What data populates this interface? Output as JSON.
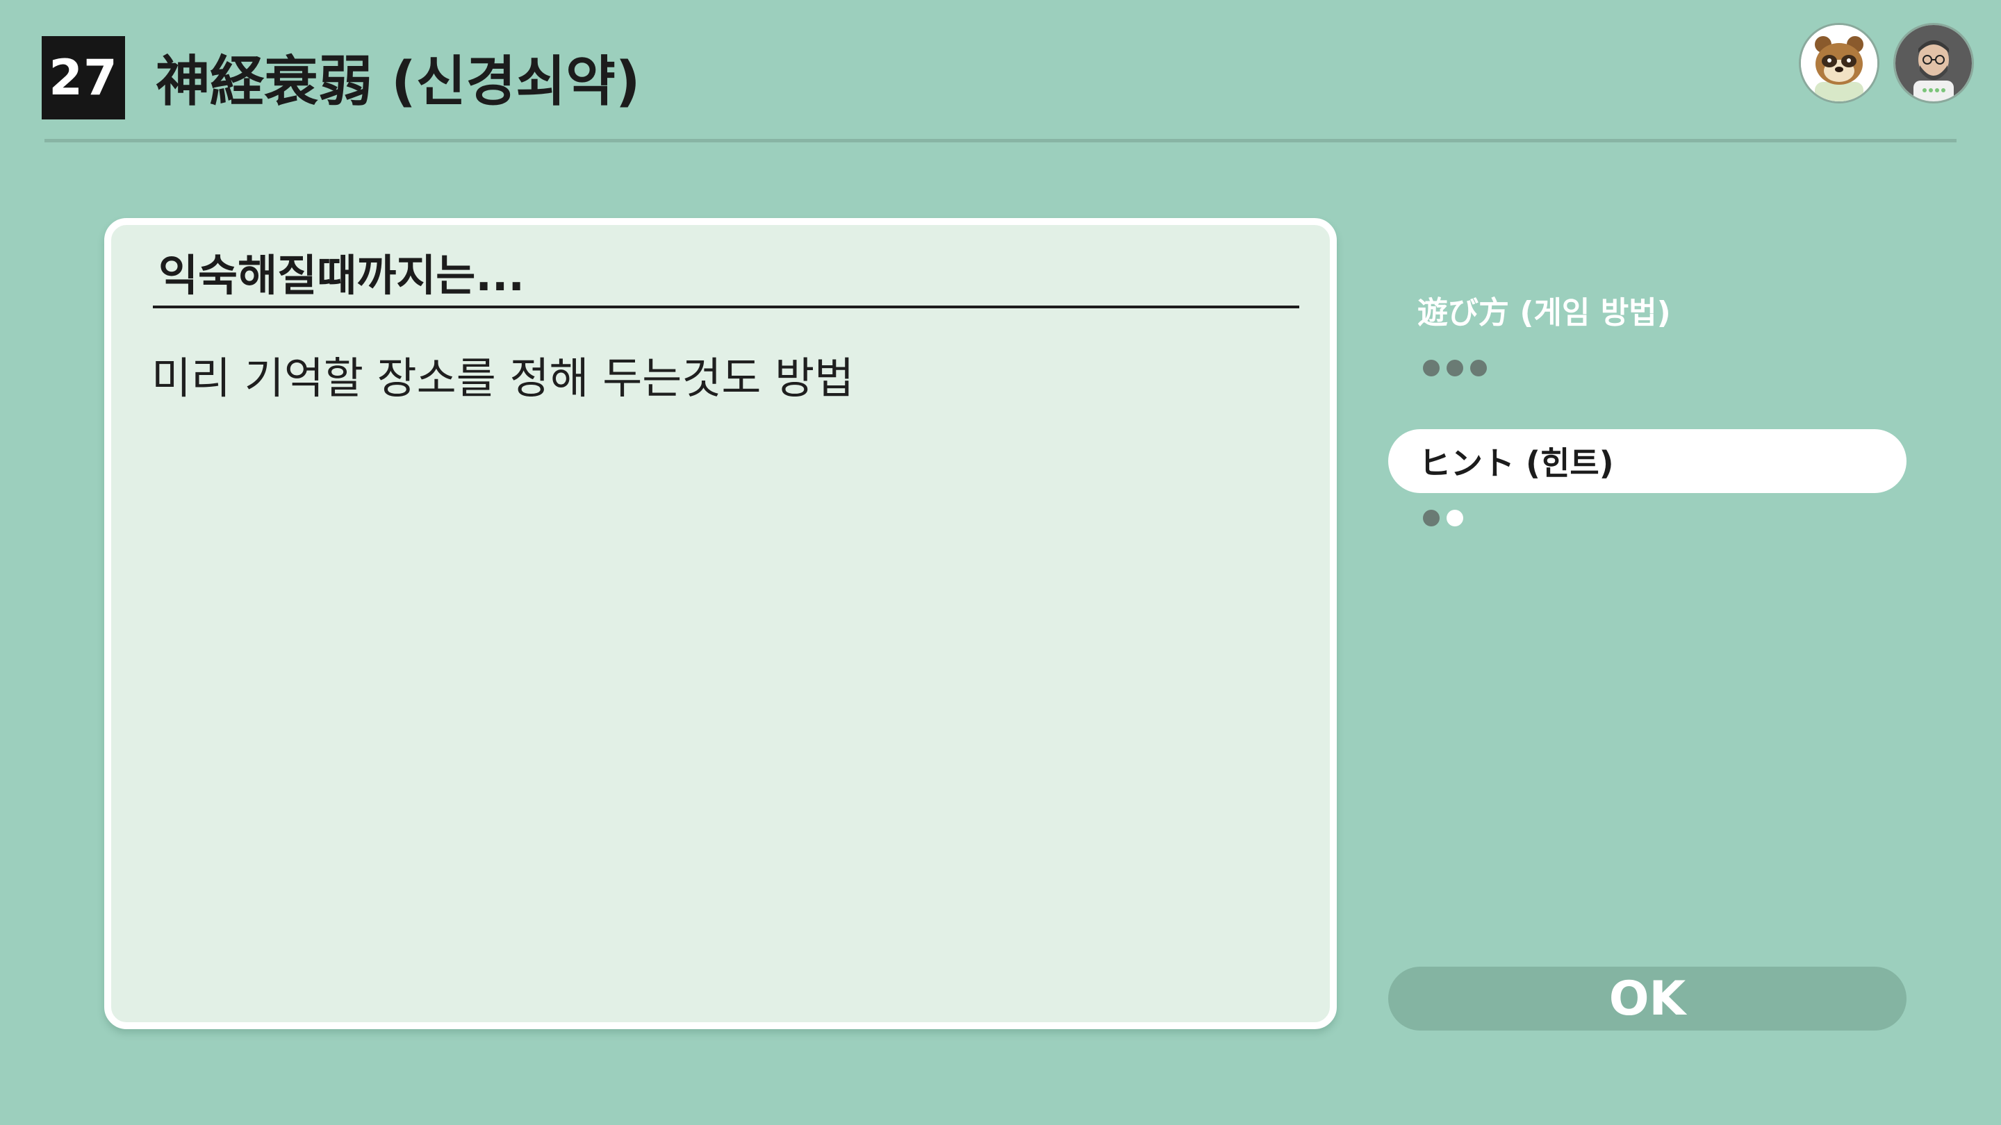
{
  "header": {
    "number": "27",
    "title": "神経衰弱 (신경쇠약)"
  },
  "avatars": {
    "first": "raccoon-character-avatar",
    "second": "bearded-man-avatar"
  },
  "panel": {
    "heading": "익숙해질때까지는...",
    "body": "미리 기억할 장소를 정해 두는것도 방법"
  },
  "sidebar": {
    "howto_label": "遊び方 (게임 방법)",
    "hint_label": "ヒント (힌트)"
  },
  "ok_label": "OK"
}
